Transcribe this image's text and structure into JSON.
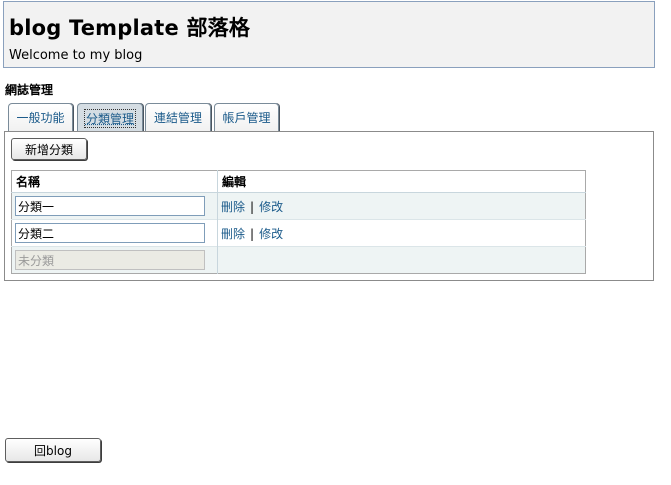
{
  "header": {
    "title": "blog Template 部落格",
    "subtitle": "Welcome to my blog"
  },
  "section": {
    "heading": "網誌管理"
  },
  "tabs": [
    {
      "label": "一般功能",
      "active": false
    },
    {
      "label": "分類管理",
      "active": true
    },
    {
      "label": "連結管理",
      "active": false
    },
    {
      "label": "帳戶管理",
      "active": false
    }
  ],
  "toolbar": {
    "add_category_label": "新增分類"
  },
  "table": {
    "columns": [
      "名稱",
      "編輯"
    ],
    "rows": [
      {
        "name": "分類一",
        "delete": "刪除",
        "separator": "|",
        "edit": "修改"
      },
      {
        "name": "分類二",
        "delete": "刪除",
        "separator": "|",
        "edit": "修改"
      },
      {
        "name": "未分類"
      }
    ]
  },
  "footer": {
    "back_label": "回blog"
  }
}
